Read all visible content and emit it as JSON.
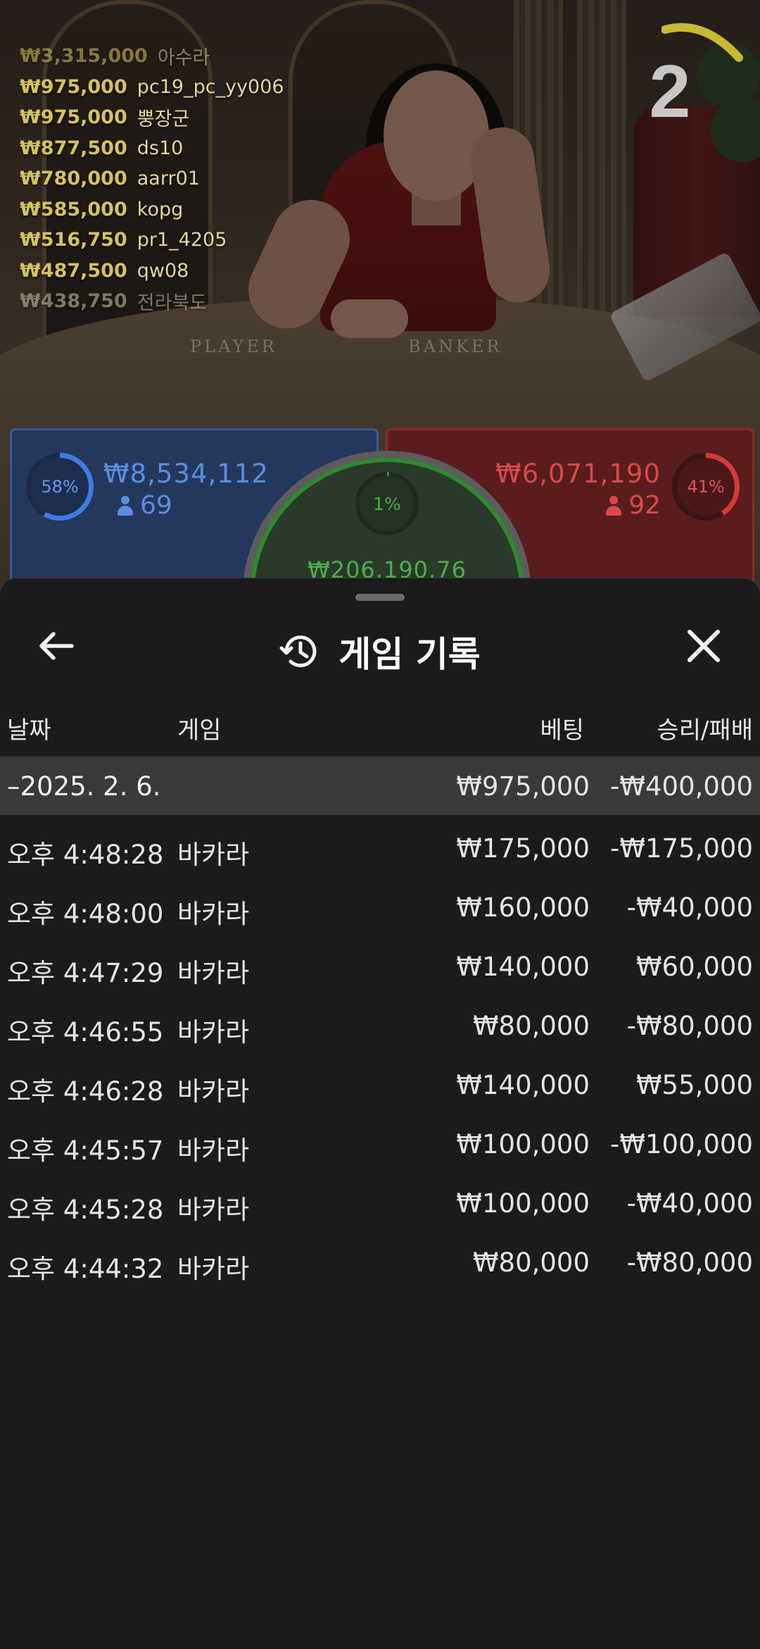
{
  "leaderboard": [
    {
      "amount": "₩3,315,000",
      "name": "아수라"
    },
    {
      "amount": "₩975,000",
      "name": "pc19_pc_yy006"
    },
    {
      "amount": "₩975,000",
      "name": "뿡장군"
    },
    {
      "amount": "₩877,500",
      "name": "ds10"
    },
    {
      "amount": "₩780,000",
      "name": "aarr01"
    },
    {
      "amount": "₩585,000",
      "name": "kopg"
    },
    {
      "amount": "₩516,750",
      "name": "pr1_4205"
    },
    {
      "amount": "₩487,500",
      "name": "qw08"
    },
    {
      "amount": "₩438,750",
      "name": "전라북도"
    }
  ],
  "table": {
    "countdown": "2",
    "player_label": "PLAYER",
    "banker_label": "BANKER"
  },
  "bets": {
    "player": {
      "percent": "58%",
      "percent_value": 58,
      "amount": "₩8,534,112",
      "count": "69",
      "color": "#3f7be0"
    },
    "banker": {
      "percent": "41%",
      "percent_value": 41,
      "amount": "₩6,071,190",
      "count": "92",
      "color": "#d63a3a"
    },
    "tie": {
      "percent": "1%",
      "percent_value": 1,
      "amount": "₩206,190.76",
      "color": "#3fa33f"
    }
  },
  "sheet": {
    "title": "게임 기록",
    "back_icon": "arrow-left-icon",
    "history_icon": "history-clock-icon",
    "close_icon": "close-icon",
    "columns": {
      "date": "날짜",
      "game": "게임",
      "bet": "베팅",
      "result": "승리/패배"
    },
    "group": {
      "date": "–2025. 2. 6.",
      "bet": "₩975,000",
      "result": "-₩400,000"
    },
    "rows": [
      {
        "time": "오후 4:48:28",
        "game": "바카라",
        "bet": "₩175,000",
        "result": "-₩175,000"
      },
      {
        "time": "오후 4:48:00",
        "game": "바카라",
        "bet": "₩160,000",
        "result": "-₩40,000"
      },
      {
        "time": "오후 4:47:29",
        "game": "바카라",
        "bet": "₩140,000",
        "result": "₩60,000"
      },
      {
        "time": "오후 4:46:55",
        "game": "바카라",
        "bet": "₩80,000",
        "result": "-₩80,000"
      },
      {
        "time": "오후 4:46:28",
        "game": "바카라",
        "bet": "₩140,000",
        "result": "₩55,000"
      },
      {
        "time": "오후 4:45:57",
        "game": "바카라",
        "bet": "₩100,000",
        "result": "-₩100,000"
      },
      {
        "time": "오후 4:45:28",
        "game": "바카라",
        "bet": "₩100,000",
        "result": "-₩40,000"
      },
      {
        "time": "오후 4:44:32",
        "game": "바카라",
        "bet": "₩80,000",
        "result": "-₩80,000"
      }
    ]
  },
  "colors": {
    "sheet_bg": "#1b1b1b",
    "group_row_bg": "#3a3a3a",
    "leaderboard_amount": "#d6c25d"
  }
}
